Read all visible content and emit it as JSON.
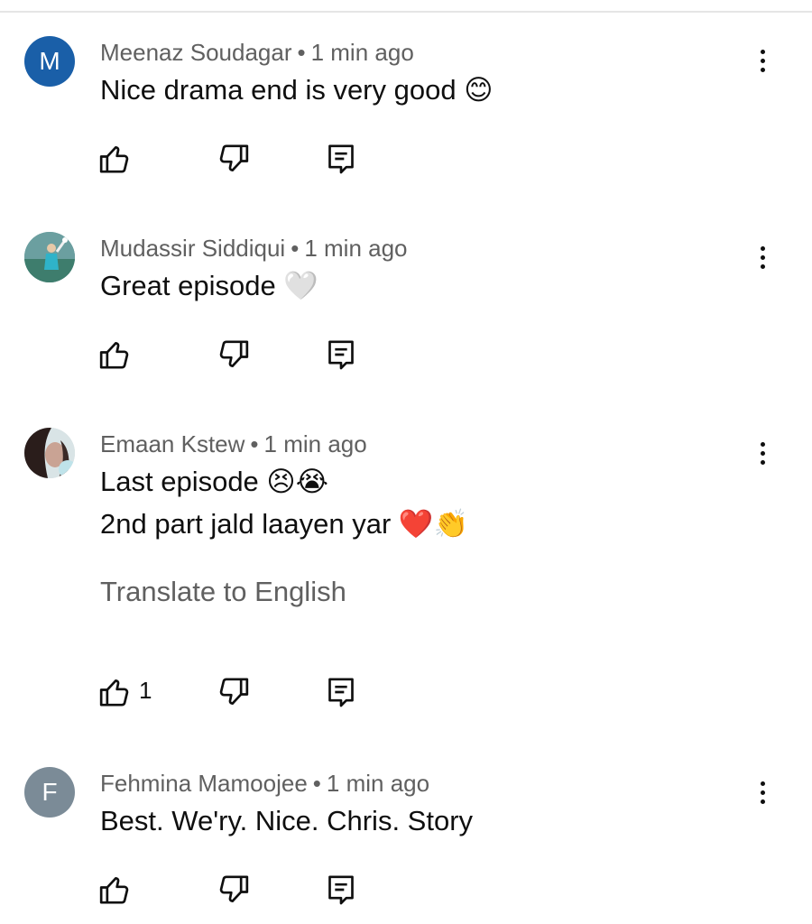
{
  "comments": [
    {
      "author": "Meenaz Soudagar",
      "separator": "•",
      "time": "1 min ago",
      "avatar_letter": "M",
      "avatar_color": "#1a5fa8",
      "lines": [
        "Nice drama end is very good 😊"
      ],
      "translate": "",
      "likes": ""
    },
    {
      "author": "Mudassir Siddiqui",
      "separator": "•",
      "time": "1 min ago",
      "avatar_letter": "",
      "avatar_color": "#4a8c8a",
      "lines": [
        "Great episode 🤍"
      ],
      "translate": "",
      "likes": ""
    },
    {
      "author": "Emaan Kstew",
      "separator": "•",
      "time": "1 min ago",
      "avatar_letter": "",
      "avatar_color": "#7a5a58",
      "lines": [
        "Last episode 😣😭",
        "2nd part jald laayen yar ❤️👏"
      ],
      "translate": "Translate to English",
      "likes": "1"
    },
    {
      "author": "Fehmina Mamoojee",
      "separator": "•",
      "time": "1 min ago",
      "avatar_letter": "F",
      "avatar_color": "#7b8b97",
      "lines": [
        "Best. We'ry. Nice. Chris. Story"
      ],
      "translate": "",
      "likes": ""
    }
  ],
  "icons": {
    "like": "thumb-up-icon",
    "dislike": "thumb-down-icon",
    "reply": "comment-reply-icon",
    "menu": "more-vert-icon"
  }
}
